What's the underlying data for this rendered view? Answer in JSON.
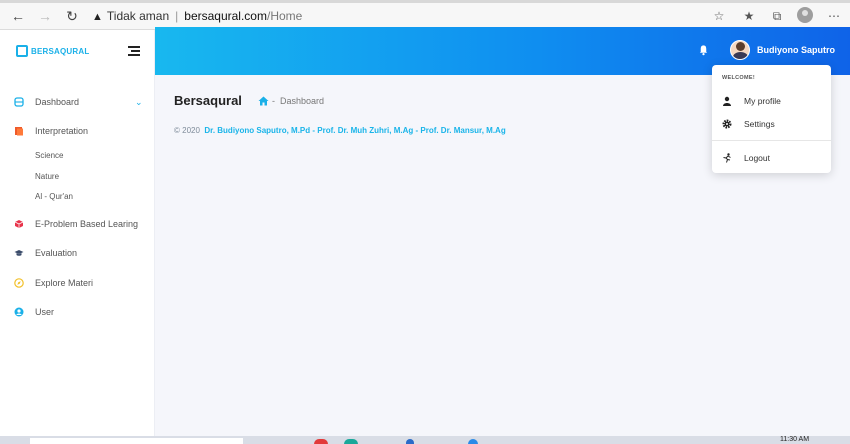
{
  "browser": {
    "security_label": "Tidak aman",
    "url_domain": "bersaqural.com",
    "url_path": "/Home"
  },
  "brand": {
    "name": "BERSAQURAL"
  },
  "sidebar": {
    "items": [
      {
        "label": "Dashboard",
        "icon": "dashboard-icon"
      },
      {
        "label": "Interpretation",
        "icon": "book-icon"
      },
      {
        "label": "E-Problem Based Learing",
        "icon": "cube-icon"
      },
      {
        "label": "Evaluation",
        "icon": "graduation-cap-icon"
      },
      {
        "label": "Explore Materi",
        "icon": "compass-icon"
      },
      {
        "label": "User",
        "icon": "user-circle-icon"
      }
    ],
    "sub_items": [
      "Science",
      "Nature",
      "Al - Qur'an"
    ]
  },
  "header": {
    "username": "Budiyono Saputro"
  },
  "main": {
    "title": "Bersaqural",
    "breadcrumb_separator": "-",
    "breadcrumb_current": "Dashboard"
  },
  "footer": {
    "prefix": "© 2020",
    "authors": "Dr. Budiyono Saputro, M.Pd - Prof. Dr. Muh Zuhri, M.Ag - Prof. Dr. Mansur, M.Ag"
  },
  "dropdown": {
    "title": "WELCOME!",
    "items": [
      {
        "label": "My profile",
        "icon": "user-icon"
      },
      {
        "label": "Settings",
        "icon": "gear-icon"
      },
      {
        "label": "Logout",
        "icon": "logout-icon"
      }
    ]
  },
  "taskbar": {
    "clock": "11:30 AM"
  },
  "colors": {
    "accent": "#1ab0e8",
    "header_start": "#18b8ef",
    "header_end": "#0f63e8"
  }
}
